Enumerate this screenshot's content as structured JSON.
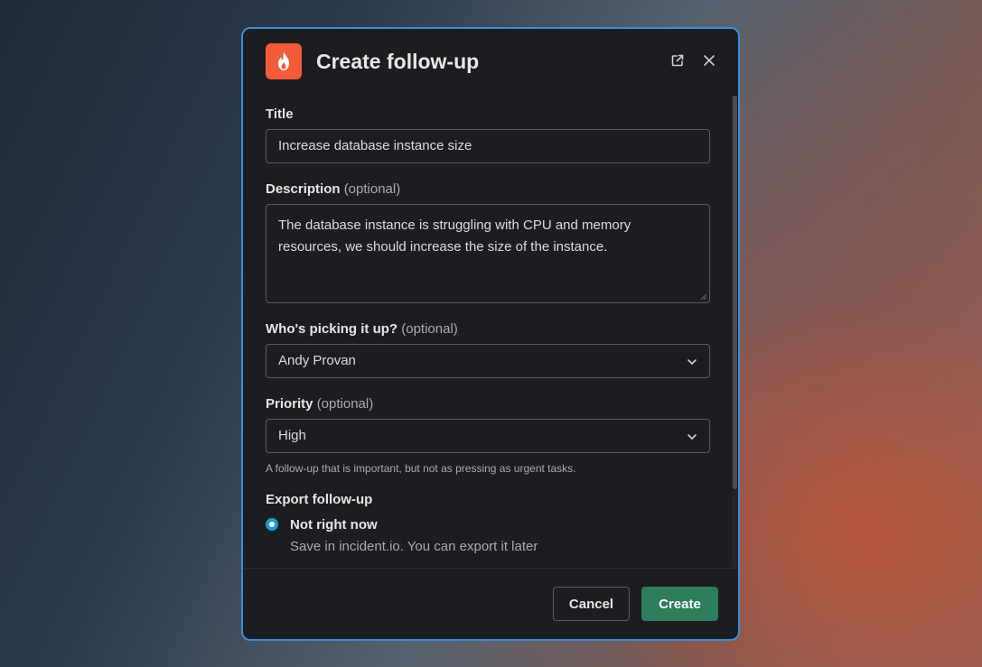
{
  "modal": {
    "title": "Create follow-up",
    "colors": {
      "accent_border": "#3b8edb",
      "app_icon_bg": "#f25c3b",
      "create_button": "#2e7d5b",
      "radio": "#1d9bd1"
    },
    "icons": {
      "app": "flame-icon",
      "open_external": "external-link-icon",
      "close": "close-icon"
    }
  },
  "form": {
    "title_label": "Title",
    "title_value": "Increase database instance size",
    "description_label": "Description",
    "description_optional": "(optional)",
    "description_value": "The database instance is struggling with CPU and memory resources, we should increase the size of the instance.",
    "assignee_label": "Who's picking it up?",
    "assignee_optional": "(optional)",
    "assignee_value": "Andy Provan",
    "priority_label": "Priority",
    "priority_optional": "(optional)",
    "priority_value": "High",
    "priority_hint": "A follow-up that is important, but not as pressing as urgent tasks.",
    "export_label": "Export follow-up",
    "export_option_title": "Not right now",
    "export_option_desc": "Save in incident.io. You can export it later"
  },
  "footer": {
    "cancel_label": "Cancel",
    "create_label": "Create"
  }
}
